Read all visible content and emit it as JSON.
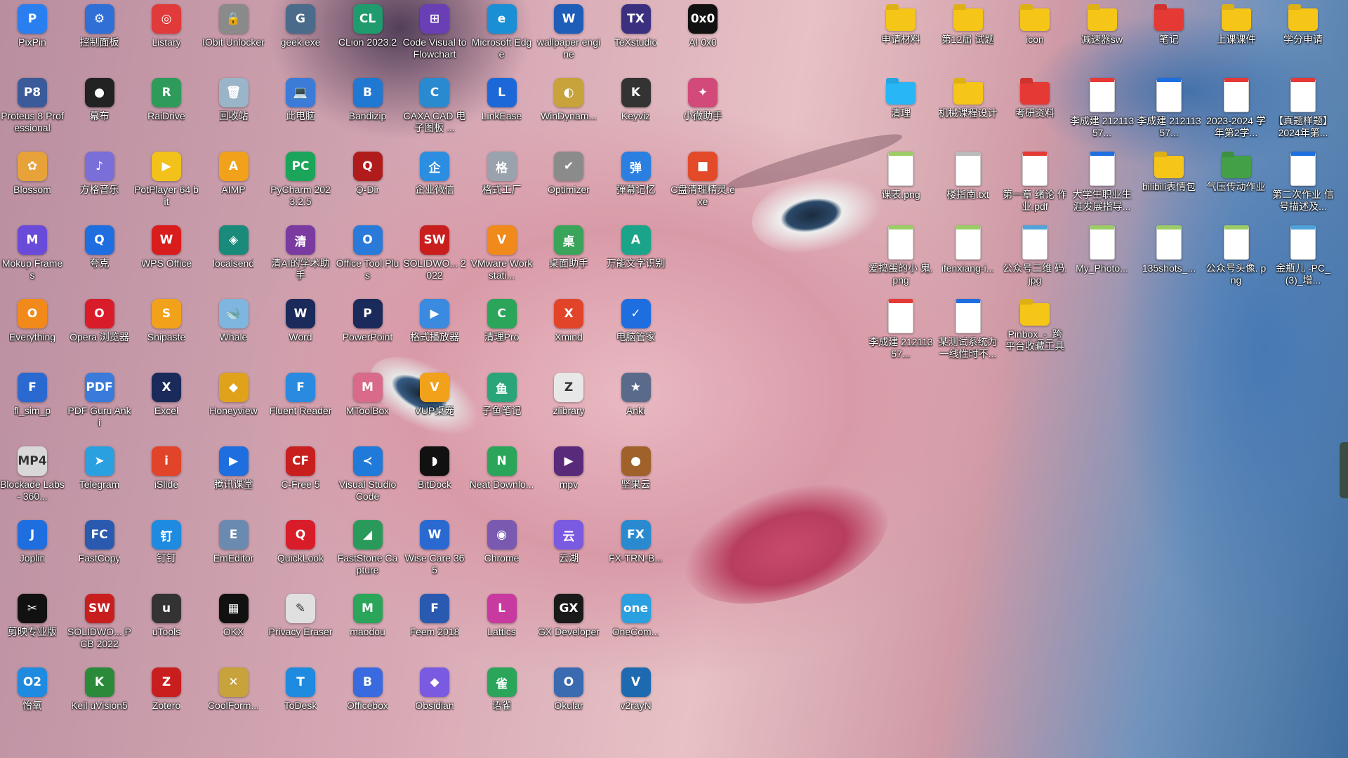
{
  "desktop": {
    "accent": "#ffd24a",
    "icons": [
      {
        "label": "PixPin",
        "glyph": "P",
        "color": "#2a7ff0",
        "icon": "pixpin-icon"
      },
      {
        "label": "控制面板",
        "glyph": "⚙",
        "color": "#2f6fd6",
        "icon": "control-panel-icon"
      },
      {
        "label": "Listary",
        "glyph": "◎",
        "color": "#e03a3a",
        "icon": "listary-icon"
      },
      {
        "label": "IObit Unlocker",
        "glyph": "🔒",
        "color": "#8a8a8a",
        "icon": "lock-icon"
      },
      {
        "label": "geek.exe",
        "glyph": "G",
        "color": "#4b6b8a",
        "icon": "geek-icon"
      },
      {
        "label": "CLion 2023.2",
        "glyph": "CL",
        "color": "#1f9b6e",
        "icon": "clion-icon"
      },
      {
        "label": "Code Visual to Flowchart",
        "glyph": "⊞",
        "color": "#6a3fb5",
        "icon": "flowchart-icon"
      },
      {
        "label": "Microsoft Edge",
        "glyph": "e",
        "color": "#1b8fd6",
        "icon": "edge-icon"
      },
      {
        "label": "wallpaper engine",
        "glyph": "W",
        "color": "#1e5db8",
        "icon": "wallpaper-engine-icon"
      },
      {
        "label": "TeXstudio",
        "glyph": "TX",
        "color": "#3b2f80",
        "icon": "texstudio-icon"
      },
      {
        "label": "AI 0x0",
        "glyph": "0x0",
        "color": "#111111",
        "icon": "ai-icon"
      },
      {
        "label": "Proteus 8 Professional",
        "glyph": "P8",
        "color": "#3a5a9a",
        "icon": "proteus-icon"
      },
      {
        "label": "幕布",
        "glyph": "●",
        "color": "#222222",
        "icon": "mubu-icon"
      },
      {
        "label": "RaiDrive",
        "glyph": "R",
        "color": "#2e9b5a",
        "icon": "raidrive-icon"
      },
      {
        "label": "回收站",
        "glyph": "🗑",
        "color": "#9ab4c8",
        "icon": "recycle-bin-icon"
      },
      {
        "label": "此电脑",
        "glyph": "💻",
        "color": "#3c7bd8",
        "icon": "this-pc-icon"
      },
      {
        "label": "Bandizip",
        "glyph": "B",
        "color": "#1f78d2",
        "icon": "bandizip-icon"
      },
      {
        "label": "CAXA CAD 电子图板 ...",
        "glyph": "C",
        "color": "#2a8ad0",
        "icon": "caxa-icon"
      },
      {
        "label": "LinkEase",
        "glyph": "L",
        "color": "#1c68d9",
        "icon": "linkease-icon"
      },
      {
        "label": "WinDynam...",
        "glyph": "◐",
        "color": "#c8a23a",
        "icon": "windynamic-icon"
      },
      {
        "label": "Keyviz",
        "glyph": "K",
        "color": "#333333",
        "icon": "keyviz-icon"
      },
      {
        "label": "小微助手",
        "glyph": "✦",
        "color": "#d24a7a",
        "icon": "assistant-icon"
      },
      {
        "label": "Blossom",
        "glyph": "✿",
        "color": "#e7a23a",
        "icon": "blossom-icon"
      },
      {
        "label": "方格音乐",
        "glyph": "♪",
        "color": "#7a6ed9",
        "icon": "music-icon"
      },
      {
        "label": "PotPlayer 64 bit",
        "glyph": "▶",
        "color": "#f2c21b",
        "icon": "potplayer-icon"
      },
      {
        "label": "AIMP",
        "glyph": "A",
        "color": "#f2a11b",
        "icon": "aimp-icon"
      },
      {
        "label": "PyCharm 2023.2.5",
        "glyph": "PC",
        "color": "#1aa55a",
        "icon": "pycharm-icon"
      },
      {
        "label": "Q-Dir",
        "glyph": "Q",
        "color": "#b01c1c",
        "icon": "qdir-icon"
      },
      {
        "label": "企业微信",
        "glyph": "企",
        "color": "#2b8ee0",
        "icon": "wecom-icon"
      },
      {
        "label": "格式工厂",
        "glyph": "格",
        "color": "#9aa3ad",
        "icon": "format-factory-icon"
      },
      {
        "label": "Optimizer",
        "glyph": "✔",
        "color": "#8b8b8b",
        "icon": "optimizer-icon"
      },
      {
        "label": "弹幕记忆",
        "glyph": "弹",
        "color": "#2a7fe0",
        "icon": "danmaku-icon"
      },
      {
        "label": "C盘清理精灵.exe",
        "glyph": "■",
        "color": "#e24a2a",
        "icon": "cleaner-icon"
      },
      {
        "label": "Mokup Frames",
        "glyph": "M",
        "color": "#6a4ad9",
        "icon": "mokup-icon"
      },
      {
        "label": "夸克",
        "glyph": "Q",
        "color": "#1e6ee0",
        "icon": "quark-icon"
      },
      {
        "label": "WPS Office",
        "glyph": "W",
        "color": "#d91c1c",
        "icon": "wps-icon"
      },
      {
        "label": "localsend",
        "glyph": "◈",
        "color": "#1a8a7a",
        "icon": "localsend-icon"
      },
      {
        "label": "清AI的学术助手",
        "glyph": "清",
        "color": "#7a3aa0",
        "icon": "academic-icon"
      },
      {
        "label": "Office Tool Plus",
        "glyph": "O",
        "color": "#2a7ad9",
        "icon": "office-tool-icon"
      },
      {
        "label": "SOLIDWO... 2022",
        "glyph": "SW",
        "color": "#c81e1e",
        "icon": "solidworks-icon"
      },
      {
        "label": "VMware Workstati...",
        "glyph": "V",
        "color": "#f08a1b",
        "icon": "vmware-icon"
      },
      {
        "label": "桌面助手",
        "glyph": "桌",
        "color": "#3aa55a",
        "icon": "desktop-helper-icon"
      },
      {
        "label": "万能文字识别",
        "glyph": "A",
        "color": "#1aa58a",
        "icon": "ocr-icon"
      },
      {
        "label": "Everything",
        "glyph": "O",
        "color": "#f28a1b",
        "icon": "everything-icon"
      },
      {
        "label": "Opera 浏览器",
        "glyph": "O",
        "color": "#d91c2a",
        "icon": "opera-icon"
      },
      {
        "label": "Snipaste",
        "glyph": "S",
        "color": "#f2a11b",
        "icon": "snipaste-icon"
      },
      {
        "label": "Whale",
        "glyph": "🐋",
        "color": "#7fb6e0",
        "icon": "whale-icon"
      },
      {
        "label": "Word",
        "glyph": "W",
        "color": "#1a2a5a",
        "icon": "word-icon"
      },
      {
        "label": "PowerPoint",
        "glyph": "P",
        "color": "#1a2a5a",
        "icon": "powerpoint-icon"
      },
      {
        "label": "格式播放器",
        "glyph": "▶",
        "color": "#3a8ae0",
        "icon": "format-player-icon"
      },
      {
        "label": "清理Pro",
        "glyph": "C",
        "color": "#2aa55a",
        "icon": "clean-pro-icon"
      },
      {
        "label": "Xmind",
        "glyph": "X",
        "color": "#e2442a",
        "icon": "xmind-icon"
      },
      {
        "label": "电脑管家",
        "glyph": "✓",
        "color": "#1e6ee0",
        "icon": "pc-manager-icon"
      },
      {
        "label": "fl_sim_p",
        "glyph": "F",
        "color": "#2a6ad0",
        "icon": "flsim-icon"
      },
      {
        "label": "PDF Guru Anki",
        "glyph": "PDF",
        "color": "#3a7ad9",
        "icon": "pdf-guru-icon"
      },
      {
        "label": "Excel",
        "glyph": "X",
        "color": "#1a2a5a",
        "icon": "excel-icon"
      },
      {
        "label": "Honeyview",
        "glyph": "◆",
        "color": "#e0a21b",
        "icon": "honeyview-icon"
      },
      {
        "label": "Fluent Reader",
        "glyph": "F",
        "color": "#2a8ae0",
        "icon": "fluent-reader-icon"
      },
      {
        "label": "MToolBox",
        "glyph": "M",
        "color": "#d96a8a",
        "icon": "mtoolbox-icon"
      },
      {
        "label": "VUP桌宠",
        "glyph": "V",
        "color": "#f2a11b",
        "icon": "vup-icon"
      },
      {
        "label": "子鱼笔记",
        "glyph": "鱼",
        "color": "#2aa57a",
        "icon": "notes-icon"
      },
      {
        "label": "zlibrary",
        "glyph": "Z",
        "color": "#e8e8e8",
        "icon": "zlibrary-icon"
      },
      {
        "label": "Anki",
        "glyph": "★",
        "color": "#5a6a8a",
        "icon": "anki-icon"
      },
      {
        "label": "Blockade Labs - 360...",
        "glyph": "MP4",
        "color": "#d8d8d8",
        "icon": "video-file-icon"
      },
      {
        "label": "Telegram",
        "glyph": "➤",
        "color": "#2aa0e0",
        "icon": "telegram-icon"
      },
      {
        "label": "iSlide",
        "glyph": "i",
        "color": "#e2442a",
        "icon": "islide-icon"
      },
      {
        "label": "腾讯课堂",
        "glyph": "▶",
        "color": "#1e6ee0",
        "icon": "tencent-class-icon"
      },
      {
        "label": "C-Free 5",
        "glyph": "CF",
        "color": "#c81e1e",
        "icon": "cfree-icon"
      },
      {
        "label": "Visual Studio Code",
        "glyph": "≺",
        "color": "#1f7ad9",
        "icon": "vscode-icon"
      },
      {
        "label": "BitDock",
        "glyph": "◗",
        "color": "#111111",
        "icon": "bitdock-icon"
      },
      {
        "label": "Neat Downlo...",
        "glyph": "N",
        "color": "#2aa55a",
        "icon": "neat-download-icon"
      },
      {
        "label": "mpv",
        "glyph": "▶",
        "color": "#5a2a7a",
        "icon": "mpv-icon"
      },
      {
        "label": "坚果云",
        "glyph": "●",
        "color": "#a0622a",
        "icon": "nutstore-icon"
      },
      {
        "label": "Joplin",
        "glyph": "J",
        "color": "#1e6ee0",
        "icon": "joplin-icon"
      },
      {
        "label": "FastCopy",
        "glyph": "FC",
        "color": "#2a5ab0",
        "icon": "fastcopy-icon"
      },
      {
        "label": "钉钉",
        "glyph": "钉",
        "color": "#1e8ae0",
        "icon": "dingtalk-icon"
      },
      {
        "label": "EmEditor",
        "glyph": "E",
        "color": "#6a8ab0",
        "icon": "emeditor-icon"
      },
      {
        "label": "QuickLook",
        "glyph": "Q",
        "color": "#d91c2a",
        "icon": "quicklook-icon"
      },
      {
        "label": "FastStone Capture",
        "glyph": "◢",
        "color": "#2a9a5a",
        "icon": "faststone-icon"
      },
      {
        "label": "Wise Care 365",
        "glyph": "W",
        "color": "#2a6ad0",
        "icon": "wise-care-icon"
      },
      {
        "label": "Chrome",
        "glyph": "◉",
        "color": "#7a5ab0",
        "icon": "chrome-icon"
      },
      {
        "label": "云湖",
        "glyph": "云",
        "color": "#7a5ae0",
        "icon": "yunhu-icon"
      },
      {
        "label": "FX-TRN-B...",
        "glyph": "FX",
        "color": "#2a8ad0",
        "icon": "fx-trn-icon"
      },
      {
        "label": "剪映专业版",
        "glyph": "✂",
        "color": "#111111",
        "icon": "capcut-icon"
      },
      {
        "label": "SOLIDWO... PCB 2022",
        "glyph": "SW",
        "color": "#c81e1e",
        "icon": "solidworks-pcb-icon"
      },
      {
        "label": "uTools",
        "glyph": "u",
        "color": "#333333",
        "icon": "utools-icon"
      },
      {
        "label": "OKX",
        "glyph": "▦",
        "color": "#111111",
        "icon": "okx-icon"
      },
      {
        "label": "Privacy Eraser",
        "glyph": "✎",
        "color": "#e0e0e0",
        "icon": "privacy-eraser-icon"
      },
      {
        "label": "maodou",
        "glyph": "M",
        "color": "#2aa55a",
        "icon": "maodou-icon"
      },
      {
        "label": "Feem 2018",
        "glyph": "F",
        "color": "#2a5ab0",
        "icon": "feem-icon"
      },
      {
        "label": "Lattics",
        "glyph": "L",
        "color": "#c83aa0",
        "icon": "lattics-icon"
      },
      {
        "label": "GX Developer",
        "glyph": "GX",
        "color": "#1a1a1a",
        "icon": "gx-developer-icon"
      },
      {
        "label": "OneCom...",
        "glyph": "one",
        "color": "#2aa0e0",
        "icon": "onecom-icon"
      },
      {
        "label": "怡氧",
        "glyph": "O2",
        "color": "#1e8ae0",
        "icon": "yiyang-icon"
      },
      {
        "label": "Keil uVision5",
        "glyph": "K",
        "color": "#2a8a3a",
        "icon": "keil-icon"
      },
      {
        "label": "Zotero",
        "glyph": "Z",
        "color": "#c81e1e",
        "icon": "zotero-icon"
      },
      {
        "label": "CoolForm...",
        "glyph": "✕",
        "color": "#c8a23a",
        "icon": "coolform-icon"
      },
      {
        "label": "ToDesk",
        "glyph": "T",
        "color": "#1e8ae0",
        "icon": "todesk-icon"
      },
      {
        "label": "Officebox",
        "glyph": "B",
        "color": "#3a6ae0",
        "icon": "officebox-icon"
      },
      {
        "label": "Obsidian",
        "glyph": "◆",
        "color": "#7a5ae0",
        "icon": "obsidian-icon"
      },
      {
        "label": "语雀",
        "glyph": "雀",
        "color": "#2aa55a",
        "icon": "yuque-icon"
      },
      {
        "label": "Okular",
        "glyph": "O",
        "color": "#3a6ab0",
        "icon": "okular-icon"
      },
      {
        "label": "v2rayN",
        "glyph": "V",
        "color": "#1e6ab0",
        "icon": "v2rayn-icon"
      }
    ],
    "files": [
      {
        "label": "申请材料",
        "type": "folder",
        "color": "#f5c518",
        "icon": "folder-icon"
      },
      {
        "label": "第12届 试题",
        "type": "folder",
        "color": "#f5c518",
        "icon": "folder-icon"
      },
      {
        "label": "icon",
        "type": "folder",
        "color": "#f5c518",
        "icon": "folder-icon"
      },
      {
        "label": "减速器sw",
        "type": "folder",
        "color": "#f5c518",
        "icon": "folder-icon"
      },
      {
        "label": "笔记",
        "type": "folder",
        "color": "#e53935",
        "icon": "folder-icon"
      },
      {
        "label": "上课课件",
        "type": "folder",
        "color": "#f5c518",
        "icon": "folder-icon"
      },
      {
        "label": "学分申请",
        "type": "folder",
        "color": "#f5c518",
        "icon": "folder-icon"
      },
      {
        "label": "清理",
        "type": "folder",
        "color": "#29b6f6",
        "icon": "folder-icon"
      },
      {
        "label": "机械课程设计",
        "type": "folder",
        "color": "#f5c518",
        "icon": "folder-icon"
      },
      {
        "label": "考研资料",
        "type": "folder",
        "color": "#e53935",
        "icon": "folder-icon"
      },
      {
        "label": "李成建 21211357...",
        "type": "pdf",
        "color": "#e53935",
        "icon": "pdf-file-icon"
      },
      {
        "label": "李成建 21211357...",
        "type": "word",
        "color": "#1e6ee0",
        "icon": "word-file-icon"
      },
      {
        "label": "2023-2024 学年第2学...",
        "type": "pdf",
        "color": "#e53935",
        "icon": "pdf-file-icon"
      },
      {
        "label": "【真题样题】 2024年第...",
        "type": "pdf",
        "color": "#e53935",
        "icon": "pdf-file-icon"
      },
      {
        "label": "课表.png",
        "type": "image",
        "color": "#9ccc65",
        "icon": "png-file-icon"
      },
      {
        "label": "楼指南.txt",
        "type": "text",
        "color": "#bbbbbb",
        "icon": "txt-file-icon"
      },
      {
        "label": "第一章 绪论 作业.pdf",
        "type": "pdf",
        "color": "#e53935",
        "icon": "pdf-file-icon"
      },
      {
        "label": "大学生职业生 涯发展指导...",
        "type": "word",
        "color": "#1e6ee0",
        "icon": "word-file-icon"
      },
      {
        "label": "bilibili表情包",
        "type": "folder",
        "color": "#f5c518",
        "icon": "folder-icon"
      },
      {
        "label": "气压传动作业",
        "type": "folder",
        "color": "#43a047",
        "icon": "folder-icon"
      },
      {
        "label": "第二次作业 信号描述及...",
        "type": "word",
        "color": "#1e6ee0",
        "icon": "word-file-icon"
      },
      {
        "label": "爱捣蛋的小 鬼.png",
        "type": "image",
        "color": "#9ccc65",
        "icon": "png-file-icon"
      },
      {
        "label": "ifenxiang-i...",
        "type": "image",
        "color": "#9ccc65",
        "icon": "png-file-icon"
      },
      {
        "label": "公众号二维 码.jpg",
        "type": "image",
        "color": "#4fa3d9",
        "icon": "jpg-file-icon"
      },
      {
        "label": "My_Photo...",
        "type": "image",
        "color": "#9ccc65",
        "icon": "png-file-icon"
      },
      {
        "label": "135shots_...",
        "type": "image",
        "color": "#9ccc65",
        "icon": "png-file-icon"
      },
      {
        "label": "公众号头像. png",
        "type": "image",
        "color": "#9ccc65",
        "icon": "png-file-icon"
      },
      {
        "label": "金瓶儿 -PC_(3)_增...",
        "type": "image",
        "color": "#4fa3d9",
        "icon": "jpg-file-icon"
      },
      {
        "label": "李成建 21211357...",
        "type": "pdf",
        "color": "#e53935",
        "icon": "pdf-file-icon"
      },
      {
        "label": "某测试系统为 一线性时不...",
        "type": "word",
        "color": "#1e6ee0",
        "icon": "word-file-icon"
      },
      {
        "label": "Pinbox_-_跨 平台收藏工具",
        "type": "folder",
        "color": "#f5c518",
        "icon": "folder-icon"
      }
    ]
  }
}
